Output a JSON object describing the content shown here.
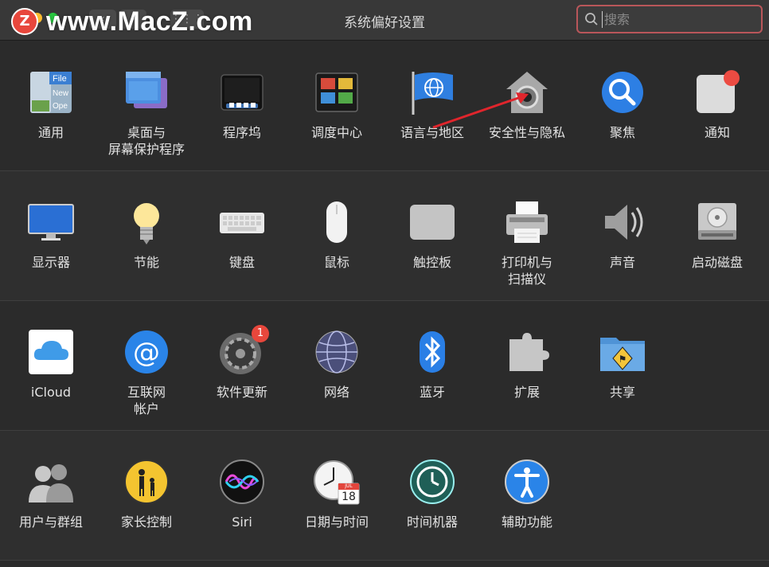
{
  "watermark": {
    "logo_letter": "Z",
    "text": "www.MacZ.com"
  },
  "window": {
    "title": "系统偏好设置"
  },
  "search": {
    "placeholder": "搜索"
  },
  "rows": [
    [
      {
        "label": "通用",
        "icon": "general-icon"
      },
      {
        "label": "桌面与\n屏幕保护程序",
        "icon": "desktop-screensaver-icon"
      },
      {
        "label": "程序坞",
        "icon": "dock-icon"
      },
      {
        "label": "调度中心",
        "icon": "mission-control-icon"
      },
      {
        "label": "语言与地区",
        "icon": "language-region-icon"
      },
      {
        "label": "安全性与隐私",
        "icon": "security-privacy-icon"
      },
      {
        "label": "聚焦",
        "icon": "spotlight-icon"
      },
      {
        "label": "通知",
        "icon": "notifications-icon"
      }
    ],
    [
      {
        "label": "显示器",
        "icon": "displays-icon"
      },
      {
        "label": "节能",
        "icon": "energy-saver-icon"
      },
      {
        "label": "键盘",
        "icon": "keyboard-icon"
      },
      {
        "label": "鼠标",
        "icon": "mouse-icon"
      },
      {
        "label": "触控板",
        "icon": "trackpad-icon"
      },
      {
        "label": "打印机与\n扫描仪",
        "icon": "printers-scanners-icon"
      },
      {
        "label": "声音",
        "icon": "sound-icon"
      },
      {
        "label": "启动磁盘",
        "icon": "startup-disk-icon"
      }
    ],
    [
      {
        "label": "iCloud",
        "icon": "icloud-icon"
      },
      {
        "label": "互联网\n帐户",
        "icon": "internet-accounts-icon"
      },
      {
        "label": "软件更新",
        "icon": "software-update-icon",
        "badge": "1"
      },
      {
        "label": "网络",
        "icon": "network-icon"
      },
      {
        "label": "蓝牙",
        "icon": "bluetooth-icon"
      },
      {
        "label": "扩展",
        "icon": "extensions-icon"
      },
      {
        "label": "共享",
        "icon": "sharing-icon"
      }
    ],
    [
      {
        "label": "用户与群组",
        "icon": "users-groups-icon"
      },
      {
        "label": "家长控制",
        "icon": "parental-controls-icon"
      },
      {
        "label": "Siri",
        "icon": "siri-icon"
      },
      {
        "label": "日期与时间",
        "icon": "date-time-icon",
        "calendar_month": "JUL",
        "calendar_day": "18"
      },
      {
        "label": "时间机器",
        "icon": "time-machine-icon"
      },
      {
        "label": "辅助功能",
        "icon": "accessibility-icon"
      }
    ]
  ],
  "colors": {
    "accent_red": "#e8473c",
    "search_border": "#b9565a",
    "annotation_arrow": "#e0252c"
  }
}
